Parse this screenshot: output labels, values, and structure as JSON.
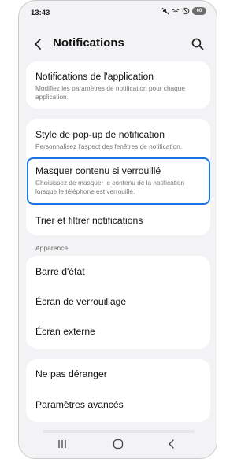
{
  "status_bar": {
    "time": "13:43",
    "battery": "60"
  },
  "header": {
    "title": "Notifications"
  },
  "cards": [
    {
      "items": [
        {
          "label": "Notifications de l'application",
          "desc": "Modifiez les paramètres de notification pour chaque application."
        }
      ]
    },
    {
      "items": [
        {
          "label": "Style de pop-up de notification",
          "desc": "Personnalisez l'aspect des fenêtres de notification."
        },
        {
          "label": "Masquer contenu si verrouillé",
          "desc": "Choisissez de masquer le contenu de la notification lorsque le téléphone est verrouillé."
        },
        {
          "label": "Trier et filtrer notifications"
        }
      ]
    },
    {
      "items": [
        {
          "label": "Barre d'état"
        },
        {
          "label": "Écran de verrouillage"
        },
        {
          "label": "Écran externe"
        }
      ]
    },
    {
      "items": [
        {
          "label": "Ne pas déranger"
        },
        {
          "label": "Paramètres avancés"
        }
      ]
    }
  ],
  "section_label": "Apparence",
  "colors": {
    "highlight": "#1a74e5",
    "background": "#f3f3f5",
    "card": "#ffffff"
  },
  "icons": [
    "back-arrow-icon",
    "search-icon",
    "recents-icon",
    "home-icon",
    "nav-back-icon"
  ]
}
